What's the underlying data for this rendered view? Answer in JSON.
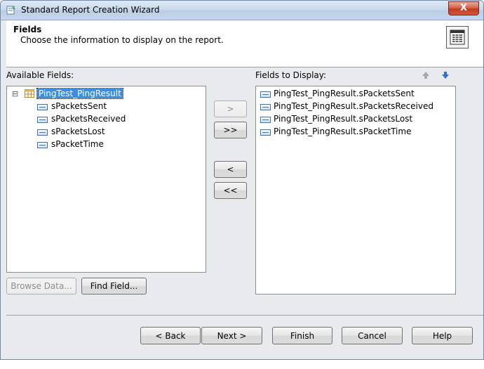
{
  "window": {
    "title": "Standard Report Creation Wizard",
    "close_glyph": "X"
  },
  "header": {
    "title": "Fields",
    "description": "Choose the information to display on the report."
  },
  "available": {
    "label": "Available Fields:",
    "tree_toggle": "⊟",
    "table_name": "PingTest_PingResult",
    "fields": [
      "sPacketsSent",
      "sPacketsReceived",
      "sPacketsLost",
      "sPacketTime"
    ]
  },
  "display": {
    "label": "Fields to Display:",
    "fields": [
      "PingTest_PingResult.sPacketsSent",
      "PingTest_PingResult.sPacketsReceived",
      "PingTest_PingResult.sPacketsLost",
      "PingTest_PingResult.sPacketTime"
    ]
  },
  "transfer": {
    "add": ">",
    "add_all": ">>",
    "remove": "<",
    "remove_all": "<<"
  },
  "buttons": {
    "browse": "Browse Data...",
    "find": "Find Field...",
    "back": "< Back",
    "next": "Next >",
    "finish": "Finish",
    "cancel": "Cancel",
    "help": "Help"
  }
}
